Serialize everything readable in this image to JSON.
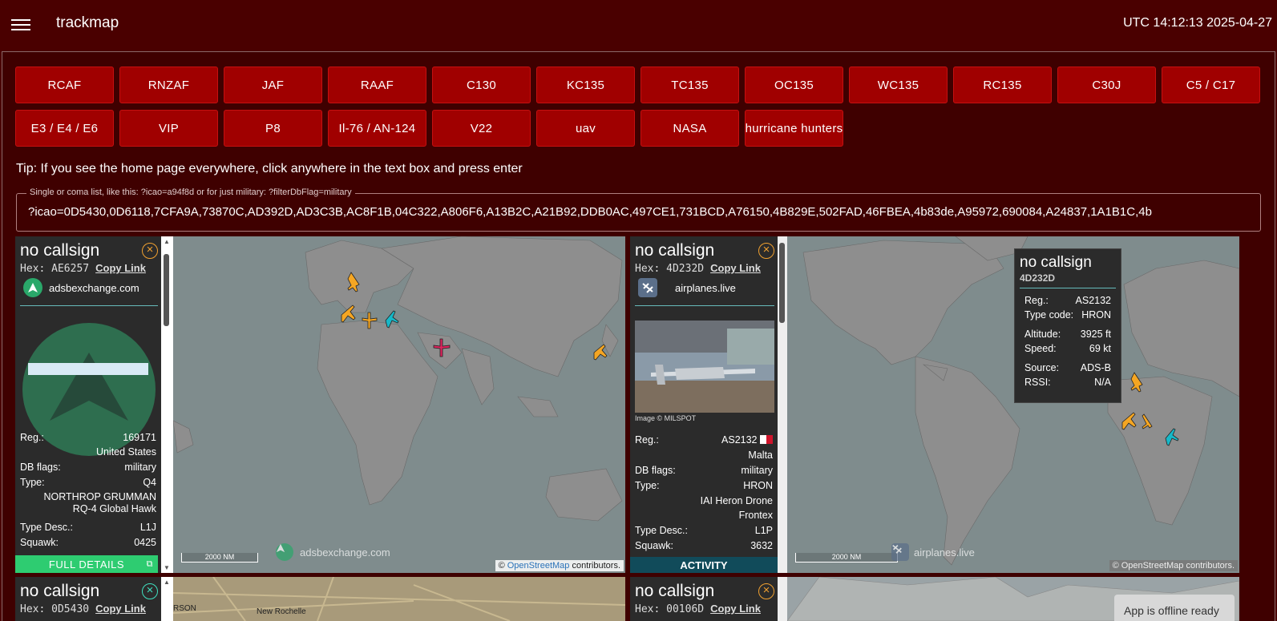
{
  "app": {
    "title": "trackmap",
    "clock": "UTC 14:12:13 2025-04-27"
  },
  "filters_row1": [
    "RCAF",
    "RNZAF",
    "JAF",
    "RAAF",
    "C130",
    "KC135",
    "TC135",
    "OC135",
    "WC135",
    "RC135",
    "C30J",
    "C5 / C17"
  ],
  "filters_row2": [
    "E3 / E4 / E6",
    "VIP",
    "P8",
    "Il-76 / AN-124",
    "V22",
    "uav",
    "NASA",
    "hurricane hunters"
  ],
  "tip": "Tip: If you see the home page everywhere, click anywhere in the text box and press enter",
  "query": {
    "legend": "Single or coma list, like this: ?icao=a94f8d or for just military: ?filterDbFlag=military",
    "value": "?icao=0D5430,0D6118,7CFA9A,73870C,AD392D,AD3C3B,AC8F1B,04C322,A806F6,A13B2C,A21B92,DDB0AC,497CE1,731BCD,A76150,4B829E,502FAD,46FBEA,4b83de,A95972,690084,A24837,1A1B1C,4b"
  },
  "panel1": {
    "callsign": "no callsign",
    "hex_label": "Hex:",
    "hex": "AE6257",
    "copy": "Copy Link",
    "source": "adsbexchange.com",
    "reg_label": "Reg.:",
    "reg": "169171",
    "country": "United States",
    "dbflags_label": "DB flags:",
    "dbflags": "military",
    "type_label": "Type:",
    "type": "Q4",
    "model1": "NORTHROP GRUMMAN",
    "model2": "RQ-4 Global Hawk",
    "typedesc_label": "Type Desc.:",
    "typedesc": "L1J",
    "squawk_label": "Squawk:",
    "squawk": "0425",
    "full_details": "FULL DETAILS",
    "scale": "2000 NM",
    "watermark": "adsbexchange.com",
    "attrib_pre": "©",
    "attrib_link": "OpenStreetMap",
    "attrib_post": "contributors."
  },
  "panel2": {
    "callsign": "no callsign",
    "hex_label": "Hex:",
    "hex": "4D232D",
    "copy": "Copy Link",
    "source": "airplanes.live",
    "image_credit": "Image © MILSPOT",
    "reg_label": "Reg.:",
    "reg": "AS2132",
    "country": "Malta",
    "dbflags_label": "DB flags:",
    "dbflags": "military",
    "type_label": "Type:",
    "type": "HRON",
    "model1": "IAI Heron Drone",
    "model2": "Frontex",
    "typedesc_label": "Type Desc.:",
    "typedesc": "L1P",
    "squawk_label": "Squawk:",
    "squawk": "3632",
    "activity": "ACTIVITY",
    "scale": "2000 NM",
    "watermark": "airplanes.live",
    "attrib_pre": "©",
    "attrib_link": "OpenStreetMap",
    "attrib_post": "contributors."
  },
  "tooltip": {
    "callsign": "no callsign",
    "hex": "4D232D",
    "reg_label": "Reg.:",
    "reg": "AS2132",
    "typecode_label": "Type code:",
    "typecode": "HRON",
    "alt_label": "Altitude:",
    "alt": "3925 ft",
    "speed_label": "Speed:",
    "speed": "69 kt",
    "source_label": "Source:",
    "source": "ADS-B",
    "rssi_label": "RSSI:",
    "rssi": "N/A"
  },
  "panel3": {
    "callsign": "no callsign",
    "hex_label": "Hex:",
    "hex": "0D5430",
    "copy": "Copy Link",
    "map_label1": "RSON",
    "map_label2": "New Rochelle"
  },
  "panel4": {
    "callsign": "no callsign",
    "hex_label": "Hex:",
    "hex": "00106D",
    "copy": "Copy Link"
  },
  "toast": "App is offline ready",
  "colors": {
    "header": "#4a0000",
    "button": "#a00000",
    "full_details": "#2ecc71",
    "activity": "#114b5a"
  }
}
